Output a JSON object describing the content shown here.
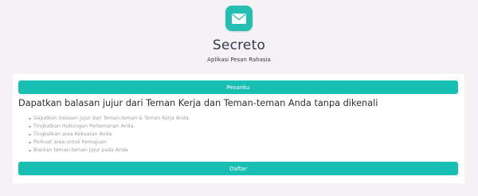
{
  "app": {
    "title": "Secreto",
    "subtitle": "Aplikasi Pesan Rahasia",
    "logo_icon": "envelope-icon",
    "accent_color": "#1abfb3"
  },
  "card": {
    "top_button_label": "Pesanku",
    "headline": "Dapatkan balasan jujur dari Teman Kerja dan Teman-teman Anda tanpa dikenali",
    "benefits": [
      "Dapatkan balasan jujur dari Teman-teman & Teman Kerja Anda.",
      "Tingkatkan Hubungan Pertemanan Anda.",
      "Tingkatkan area Kekuatan Anda",
      "Perkuat area untuk Kemajuan",
      "Biarkan teman-teman jujur pada Anda"
    ],
    "bottom_button_label": "Daftar"
  }
}
